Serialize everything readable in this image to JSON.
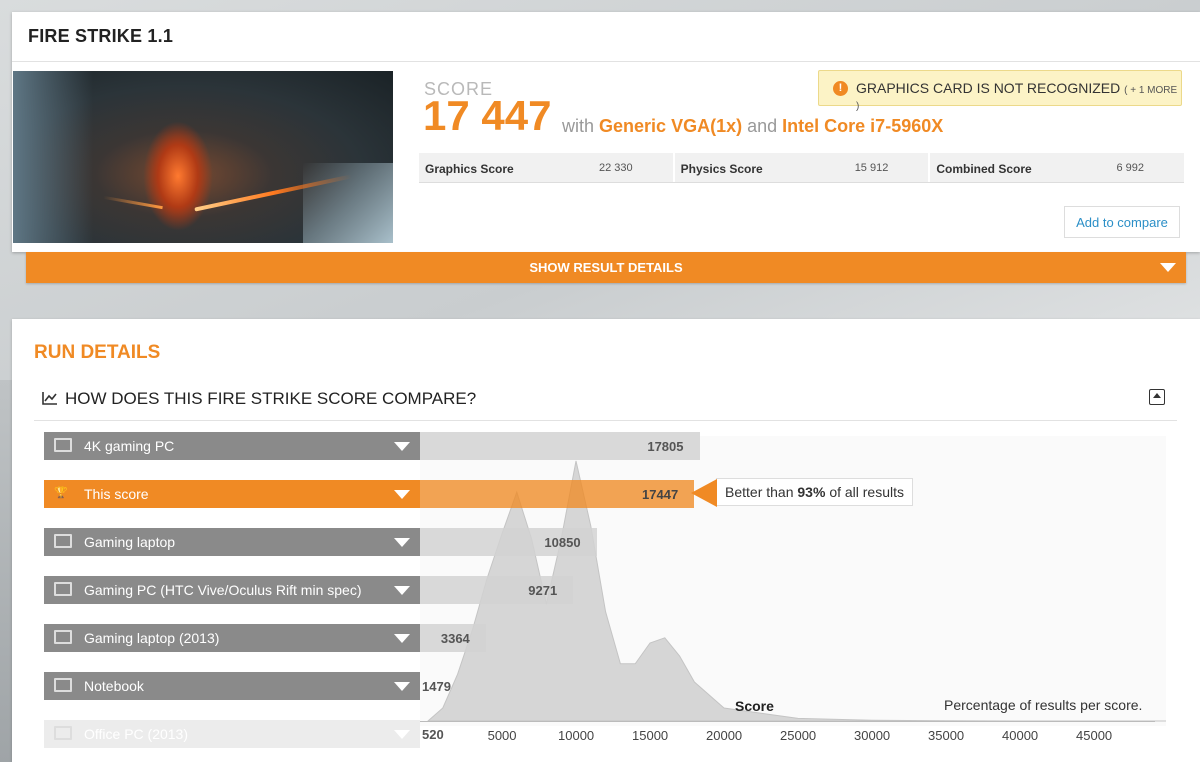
{
  "card": {
    "title": "FIRE STRIKE 1.1",
    "score_label": "SCORE",
    "score_value": "17 447",
    "with_text": "with",
    "gpu": "Generic VGA(1x)",
    "and_text": "and",
    "cpu": "Intel Core i7-5960X",
    "alert_text": "GRAPHICS CARD IS NOT RECOGNIZED",
    "alert_more": "( + 1 MORE )",
    "subscores": [
      {
        "label": "Graphics Score",
        "value": "22 330"
      },
      {
        "label": "Physics Score",
        "value": "15 912"
      },
      {
        "label": "Combined Score",
        "value": "6 992"
      }
    ],
    "compare_button": "Add to compare",
    "details_button": "SHOW RESULT DETAILS"
  },
  "run": {
    "title": "RUN DETAILS",
    "compare_heading": "HOW DOES THIS FIRE STRIKE SCORE COMPARE?",
    "better_prefix": "Better than",
    "better_pct": "93%",
    "better_suffix": "of all results",
    "rows": [
      {
        "label": "4K gaming PC",
        "value": "17805",
        "icon": "desktop-icon"
      },
      {
        "label": "This score",
        "value": "17447",
        "icon": "trophy-icon"
      },
      {
        "label": "Gaming laptop",
        "value": "10850",
        "icon": "laptop-icon"
      },
      {
        "label": "Gaming PC (HTC Vive/Oculus Rift min spec)",
        "value": "9271",
        "icon": "desktop-icon"
      },
      {
        "label": "Gaming laptop (2013)",
        "value": "3364",
        "icon": "laptop-icon"
      },
      {
        "label": "Notebook",
        "value": "1479",
        "icon": "laptop-icon"
      },
      {
        "label": "Office PC (2013)",
        "value": "520",
        "icon": "desktop-icon"
      }
    ],
    "axis_title": "Score",
    "pct_label": "Percentage of results per score.",
    "ticks": [
      "5000",
      "10000",
      "15000",
      "20000",
      "25000",
      "30000",
      "35000",
      "40000",
      "45000"
    ]
  },
  "colors": {
    "accent": "#f08a24",
    "row_gray": "#8a8a8a",
    "link": "#2b8fc7"
  },
  "chart_data": {
    "type": "area",
    "title": "",
    "xlabel": "Score",
    "ylabel": "Percentage of results per score.",
    "x": [
      0,
      1000,
      2000,
      3000,
      4000,
      5000,
      6000,
      7000,
      8000,
      9000,
      10000,
      11000,
      12000,
      13000,
      14000,
      15000,
      16000,
      17000,
      18000,
      20000,
      25000,
      30000,
      35000,
      40000,
      45000,
      50000
    ],
    "series": [
      {
        "values": [
          0,
          5,
          18,
          35,
          55,
          72,
          88,
          70,
          45,
          70,
          100,
          75,
          42,
          22,
          22,
          30,
          32,
          25,
          15,
          5,
          1,
          0.3,
          0.1,
          0,
          0,
          0
        ]
      }
    ],
    "xlim": [
      0,
      50000
    ],
    "bars": [
      {
        "name": "4K gaming PC",
        "value": 17805
      },
      {
        "name": "This score",
        "value": 17447
      },
      {
        "name": "Gaming laptop",
        "value": 10850
      },
      {
        "name": "Gaming PC (HTC Vive/Oculus Rift min spec)",
        "value": 9271
      },
      {
        "name": "Gaming laptop (2013)",
        "value": 3364
      },
      {
        "name": "Notebook",
        "value": 1479
      },
      {
        "name": "Office PC (2013)",
        "value": 520
      }
    ]
  }
}
